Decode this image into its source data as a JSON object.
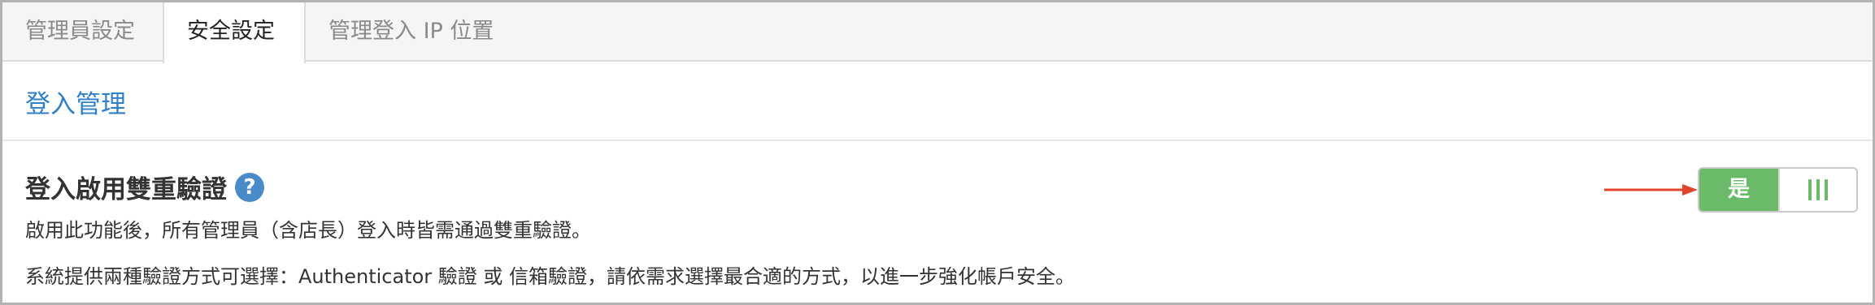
{
  "tabs": [
    {
      "label": "管理員設定",
      "active": false
    },
    {
      "label": "安全設定",
      "active": true
    },
    {
      "label": "管理登入 IP 位置",
      "active": false
    }
  ],
  "section": {
    "title": "登入管理"
  },
  "setting": {
    "title": "登入啟用雙重驗證",
    "help_icon": "question-circle-icon",
    "help_symbol": "?",
    "description_1": "啟用此功能後，所有管理員（含店長）登入時皆需通過雙重驗證。",
    "description_2": "系統提供兩種驗證方式可選擇：Authenticator 驗證 或 信箱驗證，請依需求選擇最合適的方式，以進一步強化帳戶安全。",
    "toggle": {
      "state": "on",
      "on_label": "是",
      "handle_icon": "grip-icon"
    }
  },
  "colors": {
    "link_blue": "#2f7fc9",
    "toggle_green": "#6aba6a",
    "help_blue": "#4a8ac9",
    "arrow_red": "#e0442b"
  }
}
